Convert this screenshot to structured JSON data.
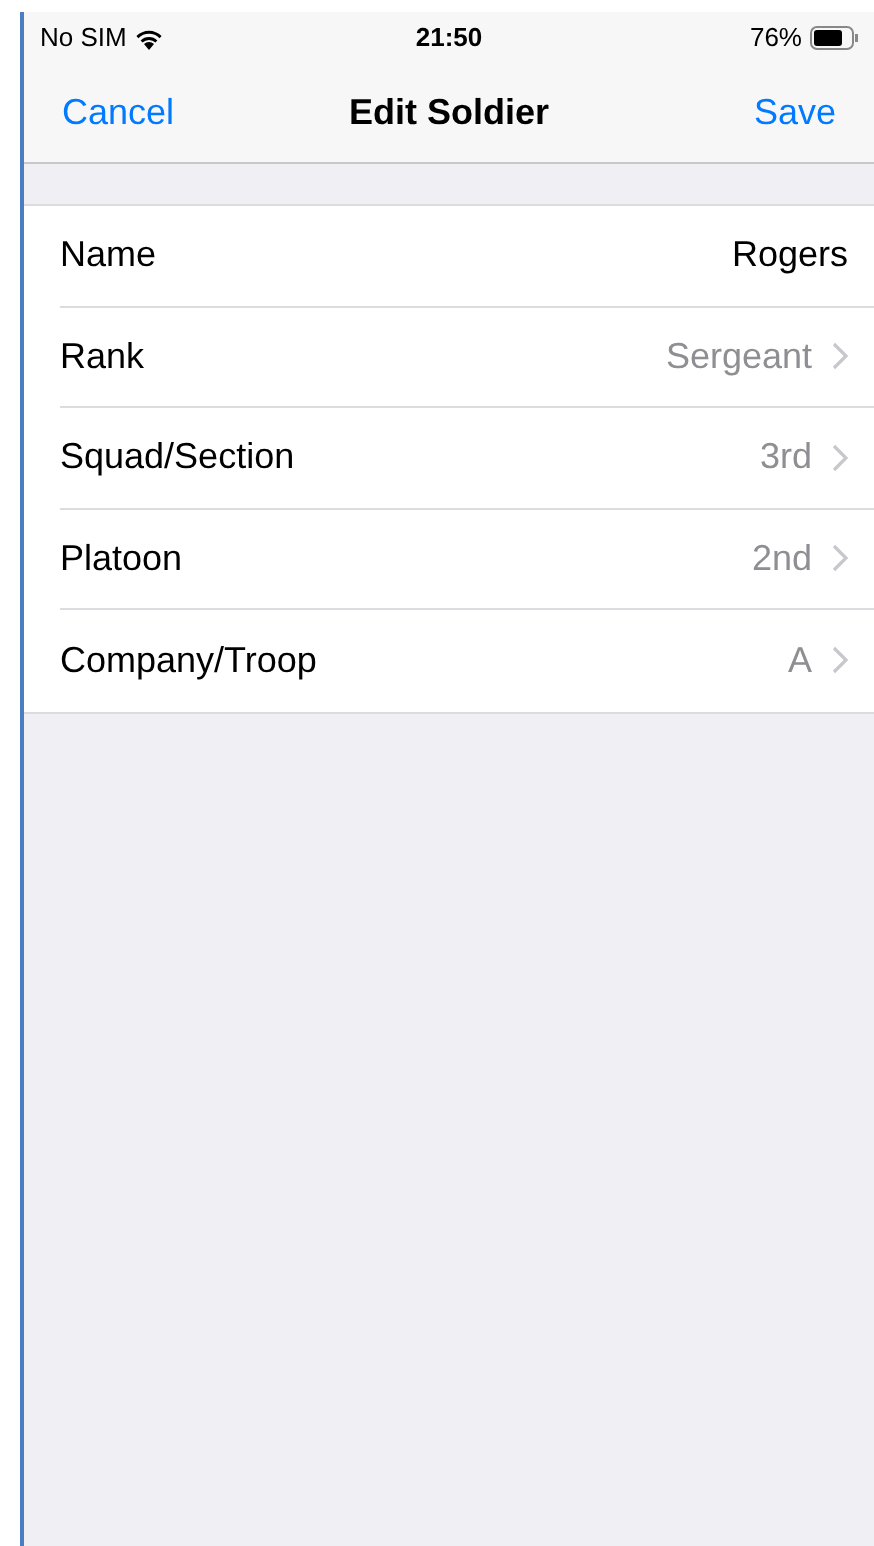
{
  "status_bar": {
    "carrier": "No SIM",
    "time": "21:50",
    "battery": "76%"
  },
  "nav_bar": {
    "left_button": "Cancel",
    "title": "Edit Soldier",
    "right_button": "Save"
  },
  "rows": [
    {
      "label": "Name",
      "value": "Rogers",
      "disclosure": false
    },
    {
      "label": "Rank",
      "value": "Sergeant",
      "disclosure": true
    },
    {
      "label": "Squad/Section",
      "value": "3rd",
      "disclosure": true
    },
    {
      "label": "Platoon",
      "value": "2nd",
      "disclosure": true
    },
    {
      "label": "Company/Troop",
      "value": "A",
      "disclosure": true
    }
  ]
}
